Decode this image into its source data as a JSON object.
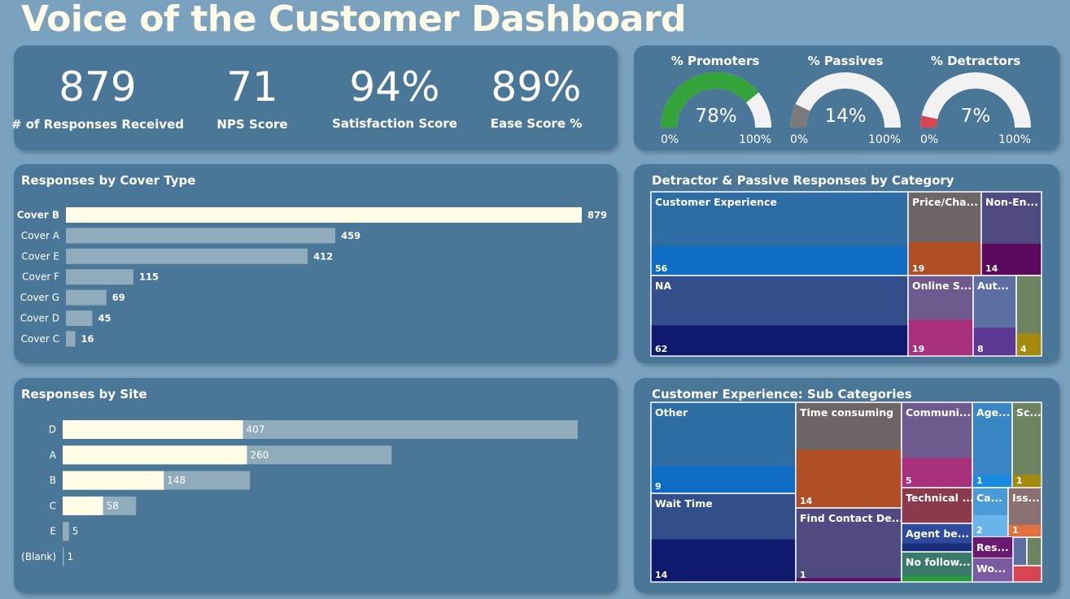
{
  "header": {
    "title": "Voice of the Customer Dashboard"
  },
  "kpis": [
    {
      "value": "879",
      "label": "# of Responses Received"
    },
    {
      "value": "71",
      "label": "NPS Score"
    },
    {
      "value": "94%",
      "label": "Satisfaction Score"
    },
    {
      "value": "89%",
      "label": "Ease Score %"
    }
  ],
  "gauges": [
    {
      "title": "% Promoters",
      "value_label": "78%",
      "fraction": 0.78,
      "min": "0%",
      "max": "100%",
      "color": "#33a33a"
    },
    {
      "title": "% Passives",
      "value_label": "14%",
      "fraction": 0.14,
      "min": "0%",
      "max": "100%",
      "color": "#7a7a7a"
    },
    {
      "title": "% Detractors",
      "value_label": "7%",
      "fraction": 0.07,
      "min": "0%",
      "max": "100%",
      "color": "#d64550"
    }
  ],
  "cover_chart": {
    "title": "Responses by Cover Type",
    "chart_data": {
      "type": "bar",
      "categories": [
        "Cover B",
        "Cover A",
        "Cover E",
        "Cover F",
        "Cover G",
        "Cover D",
        "Cover C"
      ],
      "values": [
        879,
        459,
        412,
        115,
        69,
        45,
        16
      ],
      "highlighted": "Cover B",
      "colors": {
        "highlight": "#fffde6",
        "base": "#90abbb"
      }
    }
  },
  "site_chart": {
    "title": "Responses by Site",
    "chart_data": {
      "type": "bar",
      "categories": [
        "D",
        "A",
        "B",
        "C",
        "E",
        "(Blank)"
      ],
      "series": [
        {
          "values": [
            407,
            260,
            148,
            58,
            5,
            1
          ]
        }
      ],
      "highlight_fraction": [
        0.35,
        0.56,
        0.54,
        0.55,
        0.0,
        0.0
      ],
      "colors": {
        "highlight": "#fffde6",
        "base": "#90abbb"
      }
    }
  },
  "detractor_treemap": {
    "title": "Detractor & Passive Responses by Category",
    "items": [
      {
        "label": "Customer Experience",
        "value": "56",
        "color": "#2e6da4",
        "accent": "#0e6cc4"
      },
      {
        "label": "NA",
        "value": "62",
        "color": "#324e8b",
        "accent": "#0f1a6e"
      },
      {
        "label": "Price/Cha...",
        "value": "19",
        "color": "#6e6566",
        "accent": "#b04e26"
      },
      {
        "label": "Non-En...",
        "value": "14",
        "color": "#4f4a80",
        "accent": "#5b0a5e"
      },
      {
        "label": "Online S...",
        "value": "19",
        "color": "#6f5a8e",
        "accent": "#a8307c"
      },
      {
        "label": "Aut...",
        "value": "8",
        "color": "#5b6fa2",
        "accent": "#5c3a94"
      },
      {
        "label": "",
        "value": "4",
        "color": "#6e8360",
        "accent": "#a38a0c"
      }
    ]
  },
  "subcat_treemap": {
    "title": "Customer Experience: Sub Categories",
    "items": [
      {
        "label": "Other",
        "value": "9",
        "color": "#2e6da4",
        "accent": "#0e6cc4"
      },
      {
        "label": "Wait Time",
        "value": "14",
        "color": "#324e8b",
        "accent": "#0f1a6e"
      },
      {
        "label": "Time consuming",
        "value": "14",
        "color": "#6e6566",
        "accent": "#b04e26"
      },
      {
        "label": "Find Contact De...",
        "value": "1",
        "color": "#4f4a80",
        "accent": "#5b0a5e"
      },
      {
        "label": "Communi...",
        "value": "5",
        "color": "#6f5a8e",
        "accent": "#a8307c"
      },
      {
        "label": "Technical ...",
        "value": "",
        "color": "#8a3a4a",
        "accent": "#8a3a4a"
      },
      {
        "label": "Agent be...",
        "value": "",
        "color": "#2d4a9b",
        "accent": "#1a2d7a"
      },
      {
        "label": "No follow...",
        "value": "",
        "color": "#3a7a6a",
        "accent": "#2a9a3a"
      },
      {
        "label": "Age...",
        "value": "1",
        "color": "#3a86c4",
        "accent": "#1a8ae0"
      },
      {
        "label": "Sc...",
        "value": "1",
        "color": "#6e8360",
        "accent": "#a38a0c"
      },
      {
        "label": "Ca...",
        "value": "2",
        "color": "#4a9ad8",
        "accent": "#6ab4ec"
      },
      {
        "label": "Iss...",
        "value": "1",
        "color": "#8a7070",
        "accent": "#e07040"
      },
      {
        "label": "Res...",
        "value": "",
        "color": "#6a1a6e",
        "accent": "#6a1a6e"
      },
      {
        "label": "Wo...",
        "value": "",
        "color": "#7a5aa0",
        "accent": "#7a5aa0"
      }
    ]
  }
}
